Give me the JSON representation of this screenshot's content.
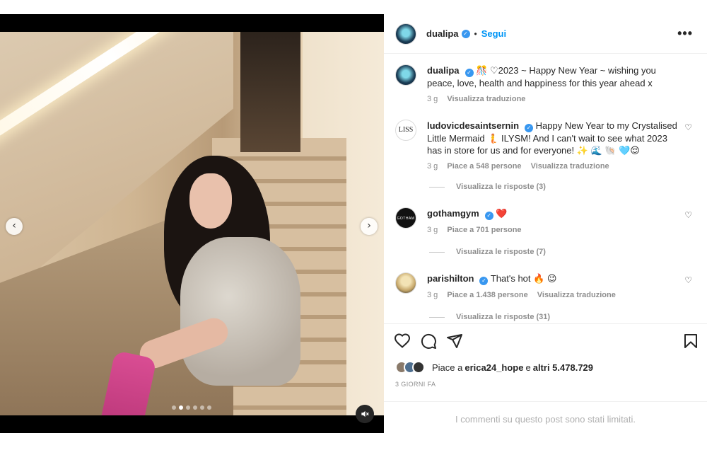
{
  "post": {
    "author": "dualipa",
    "separator": "•",
    "follow_label": "Segui",
    "more_label": "•••",
    "carousel": {
      "slide_count": 6,
      "active_index": 1
    }
  },
  "caption": {
    "username": "dualipa",
    "text": "🎊 ♡2023 ~ Happy New Year ~ wishing you peace, love, health and happiness for this year ahead x",
    "time": "3 g",
    "translate_label": "Visualizza traduzione"
  },
  "comments": [
    {
      "username": "ludovicdesaintsernin",
      "avatar_text": "LISS",
      "text": "Happy New Year to my Crystalised Little Mermaid 🧜 ILYSM! And I can't wait to see what 2023 has in store for us and for everyone! ✨ 🌊 🐚 🩵😌",
      "time": "3 g",
      "likes": "Piace a 548 persone",
      "translate_label": "Visualizza traduzione",
      "replies": "Visualizza le risposte (3)"
    },
    {
      "username": "gothamgym",
      "avatar_text": "GOTHAM",
      "text": "❤️",
      "time": "3 g",
      "likes": "Piace a 701 persone",
      "translate_label": "",
      "replies": "Visualizza le risposte (7)"
    },
    {
      "username": "parishilton",
      "avatar_text": "",
      "text": "That's hot 🔥 😉",
      "time": "3 g",
      "likes": "Piace a 1.438 persone",
      "translate_label": "Visualizza traduzione",
      "replies": "Visualizza le risposte (31)"
    }
  ],
  "actions": {
    "likes_prefix": "Piace a",
    "liked_by": "erica24_hope",
    "likes_joiner": "e",
    "likes_others": "altri 5.478.729",
    "date": "3 GIORNI FA",
    "limited_comments": "I commenti su questo post sono stati limitati."
  },
  "icons": {
    "verified": "verified-badge-icon",
    "heart": "heart-icon",
    "comment": "comment-icon",
    "share": "share-icon",
    "save": "bookmark-icon",
    "mute": "muted-speaker-icon",
    "prev": "chevron-left-icon",
    "next": "chevron-right-icon"
  },
  "colors": {
    "accent": "#0095f6",
    "verified": "#3897f0",
    "text": "#262626",
    "muted": "#8e8e8e",
    "boot": "#d94d93"
  }
}
